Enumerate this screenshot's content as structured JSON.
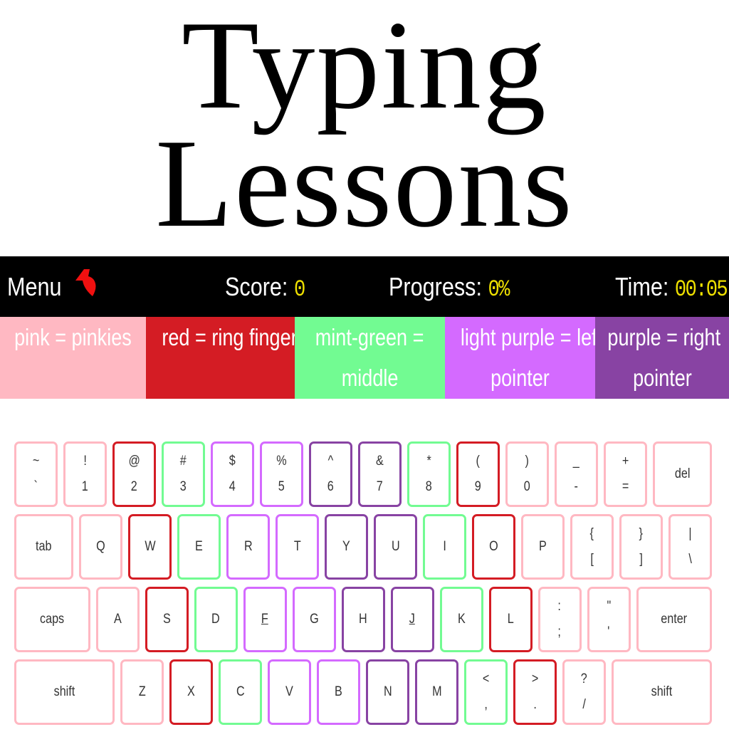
{
  "title": {
    "line1": "Typing",
    "line2": "Lessons"
  },
  "topbar": {
    "menu": "Menu",
    "back_icon": "red-back-arrow-icon",
    "score_label": "Score:",
    "score": "0",
    "progress_label": "Progress:",
    "progress": "0%",
    "time_label": "Time:",
    "time": "00:05"
  },
  "legend": [
    {
      "l1": "pink = pinkies",
      "l2": "",
      "color": "#ffb8c2"
    },
    {
      "l1": "red = ring fingers",
      "l2": "",
      "color": "#d41c24"
    },
    {
      "l1": "mint-green =",
      "l2": "middle",
      "color": "#72fb92"
    },
    {
      "l1": "light purple = left",
      "l2": "pointer",
      "color": "#d46aff"
    },
    {
      "l1": "purple = right",
      "l2": "pointer",
      "color": "#8843a3"
    }
  ],
  "colors": {
    "pink": "#ffb8c2",
    "red": "#d41c24",
    "green": "#72fb92",
    "lpurple": "#d46aff",
    "purple": "#8843a3"
  },
  "keyboard": [
    [
      {
        "t": "~",
        "b": "`",
        "f": "pink"
      },
      {
        "t": "!",
        "b": "1",
        "f": "pink"
      },
      {
        "t": "@",
        "b": "2",
        "f": "red"
      },
      {
        "t": "#",
        "b": "3",
        "f": "green"
      },
      {
        "t": "$",
        "b": "4",
        "f": "lpurple"
      },
      {
        "t": "%",
        "b": "5",
        "f": "lpurple"
      },
      {
        "t": "^",
        "b": "6",
        "f": "purple"
      },
      {
        "t": "&",
        "b": "7",
        "f": "purple"
      },
      {
        "t": "*",
        "b": "8",
        "f": "green"
      },
      {
        "t": "(",
        "b": "9",
        "f": "red"
      },
      {
        "t": ")",
        "b": "0",
        "f": "pink"
      },
      {
        "t": "_",
        "b": "-",
        "f": "pink"
      },
      {
        "t": "+",
        "b": "=",
        "f": "pink"
      },
      {
        "label": "del",
        "f": "pink"
      }
    ],
    [
      {
        "label": "tab",
        "f": "pink"
      },
      {
        "c": "Q",
        "f": "pink"
      },
      {
        "c": "W",
        "f": "red"
      },
      {
        "c": "E",
        "f": "green"
      },
      {
        "c": "R",
        "f": "lpurple"
      },
      {
        "c": "T",
        "f": "lpurple"
      },
      {
        "c": "Y",
        "f": "purple"
      },
      {
        "c": "U",
        "f": "purple"
      },
      {
        "c": "I",
        "f": "green"
      },
      {
        "c": "O",
        "f": "red"
      },
      {
        "c": "P",
        "f": "pink"
      },
      {
        "t": "{",
        "b": "[",
        "f": "pink"
      },
      {
        "t": "}",
        "b": "]",
        "f": "pink"
      },
      {
        "t": "|",
        "b": "\\",
        "f": "pink"
      }
    ],
    [
      {
        "label": "caps",
        "f": "pink"
      },
      {
        "c": "A",
        "f": "pink"
      },
      {
        "c": "S",
        "f": "red"
      },
      {
        "c": "D",
        "f": "green"
      },
      {
        "c": "F",
        "f": "lpurple",
        "home": true
      },
      {
        "c": "G",
        "f": "lpurple"
      },
      {
        "c": "H",
        "f": "purple"
      },
      {
        "c": "J",
        "f": "purple",
        "home": true
      },
      {
        "c": "K",
        "f": "green"
      },
      {
        "c": "L",
        "f": "red"
      },
      {
        "t": ":",
        "b": ";",
        "f": "pink"
      },
      {
        "t": "\"",
        "b": "'",
        "f": "pink"
      },
      {
        "label": "enter",
        "f": "pink"
      }
    ],
    [
      {
        "label": "shift",
        "f": "pink"
      },
      {
        "c": "Z",
        "f": "pink"
      },
      {
        "c": "X",
        "f": "red"
      },
      {
        "c": "C",
        "f": "green"
      },
      {
        "c": "V",
        "f": "lpurple"
      },
      {
        "c": "B",
        "f": "lpurple"
      },
      {
        "c": "N",
        "f": "purple"
      },
      {
        "c": "M",
        "f": "purple"
      },
      {
        "t": "<",
        "b": ",",
        "f": "green"
      },
      {
        "t": ">",
        "b": ".",
        "f": "red"
      },
      {
        "t": "?",
        "b": "/",
        "f": "pink"
      },
      {
        "label": "shift",
        "f": "pink"
      }
    ]
  ]
}
